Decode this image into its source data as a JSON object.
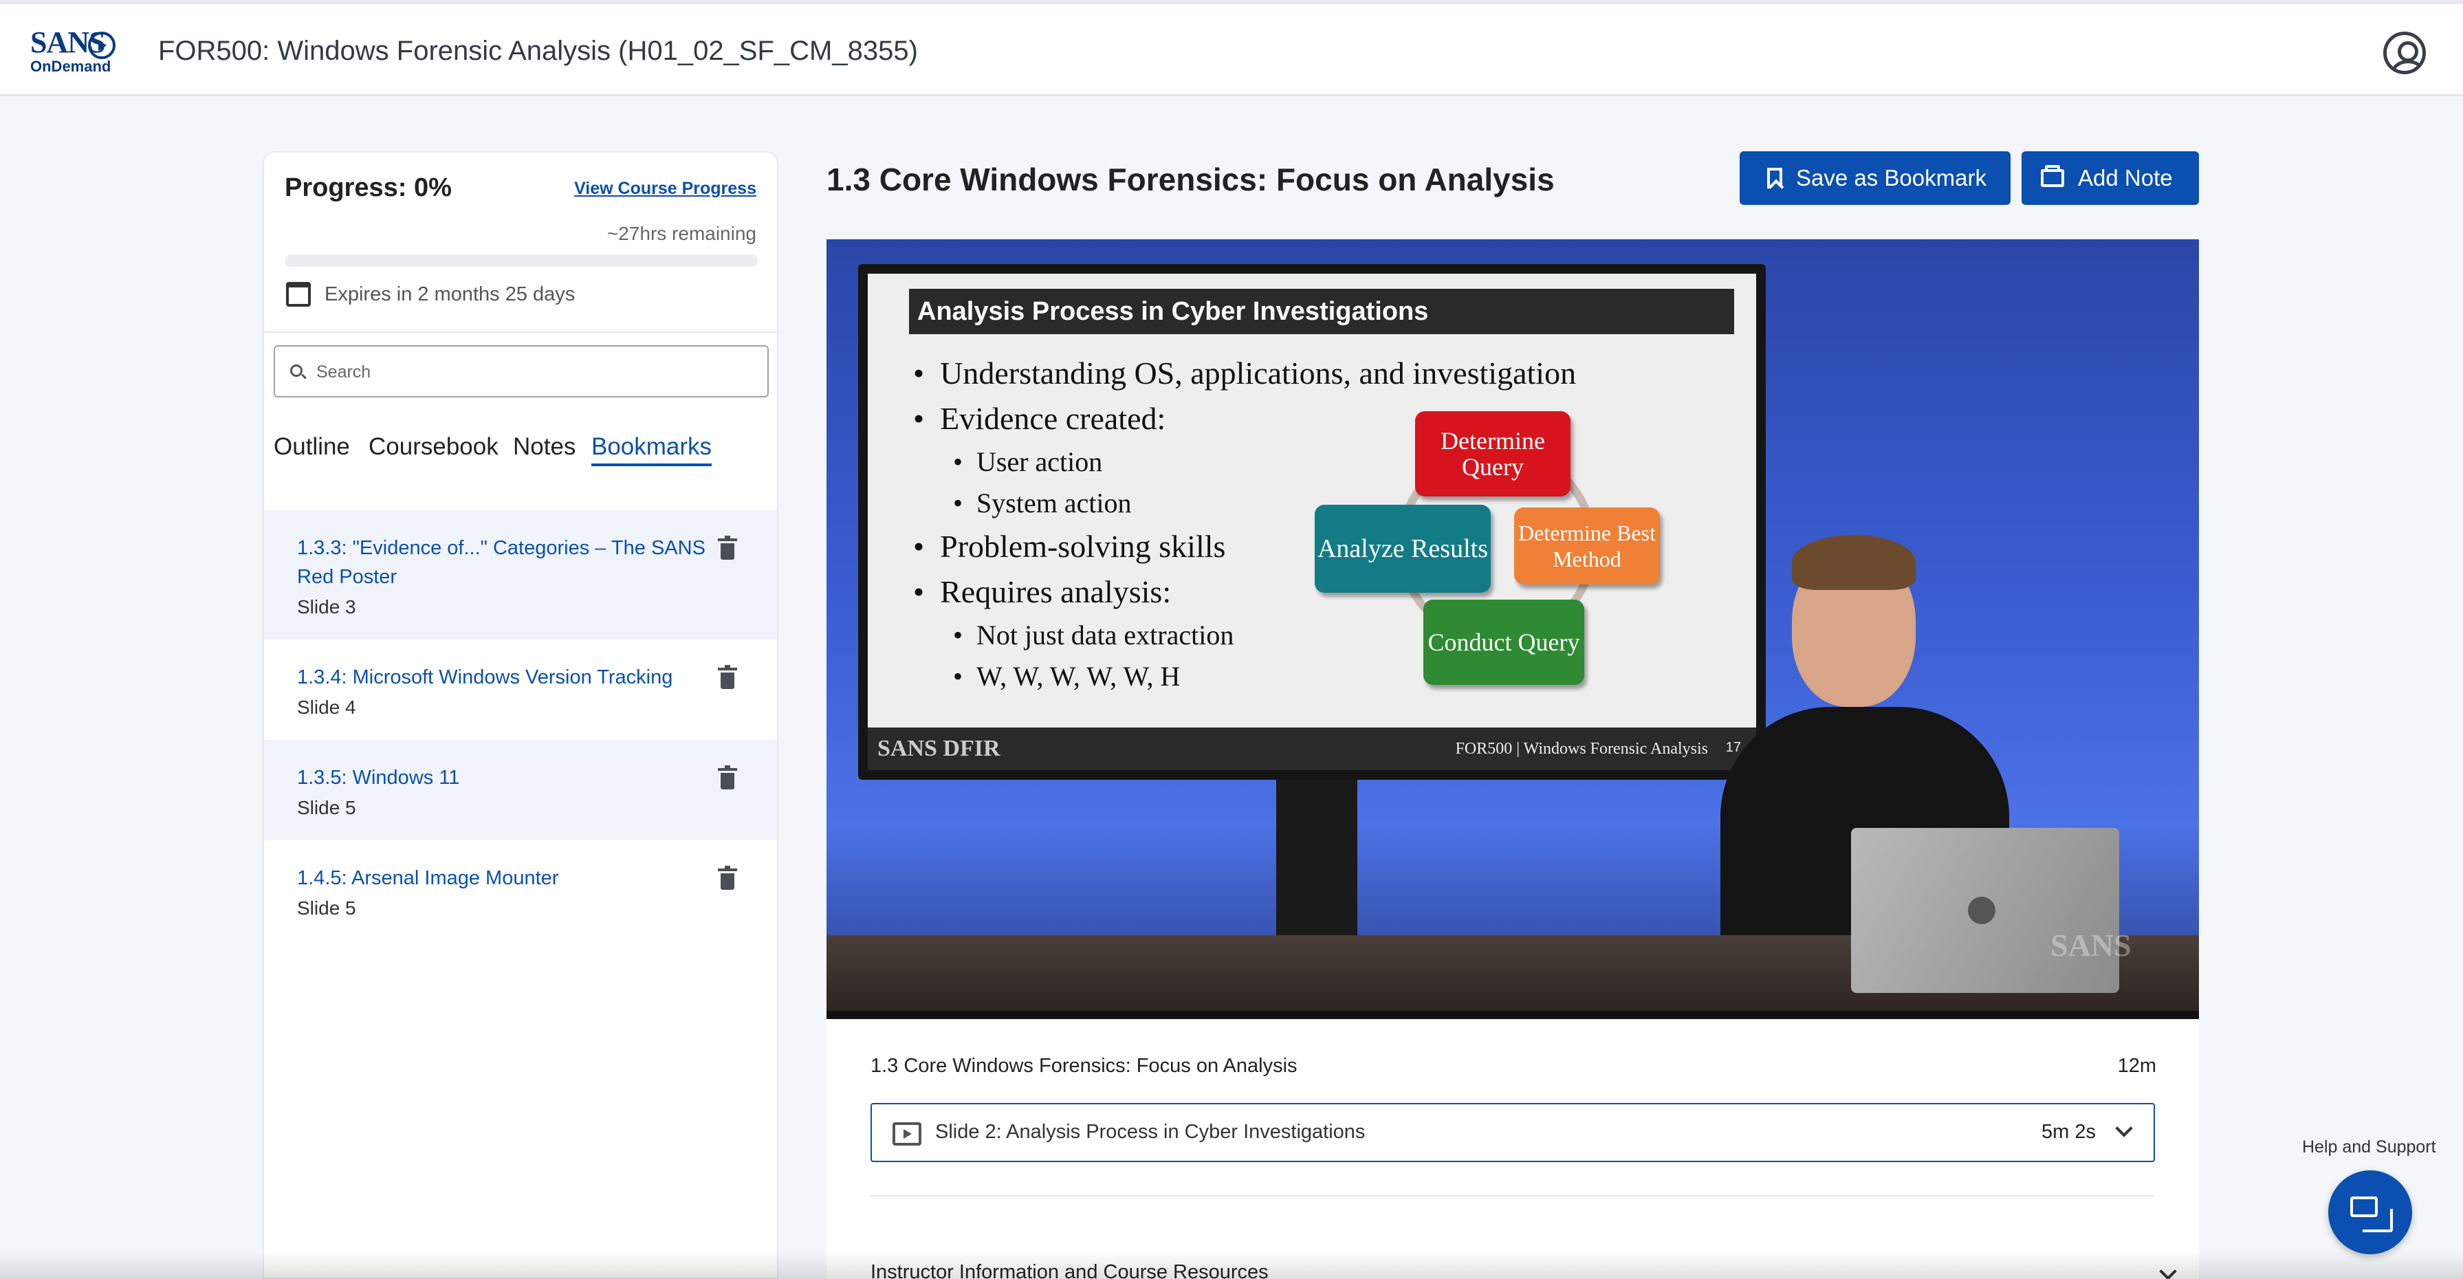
{
  "header": {
    "logo_top": "SANS",
    "logo_bottom": "OnDemand",
    "course_title": "FOR500: Windows Forensic Analysis (H01_02_SF_CM_8355)",
    "user_icon": "user-circle-icon"
  },
  "sidebar": {
    "progress_label": "Progress: 0%",
    "progress_value": 0,
    "view_progress_link": "View Course Progress",
    "remaining": "~27hrs remaining",
    "expires": "Expires in 2 months 25 days",
    "search": {
      "placeholder": "Search",
      "value": ""
    },
    "tabs": [
      {
        "label": "Outline",
        "active": false
      },
      {
        "label": "Coursebook",
        "active": false
      },
      {
        "label": "Notes",
        "active": false
      },
      {
        "label": "Bookmarks",
        "active": true
      }
    ],
    "bookmarks": [
      {
        "title": "1.3.3: \"Evidence of...\" Categories – The SANS Red Poster",
        "slide": "Slide 3"
      },
      {
        "title": "1.3.4: Microsoft Windows Version Tracking",
        "slide": "Slide 4"
      },
      {
        "title": "1.3.5: Windows 11",
        "slide": "Slide 5"
      },
      {
        "title": "1.4.5: Arsenal Image Mounter",
        "slide": "Slide 5"
      }
    ]
  },
  "main": {
    "lesson_title": "1.3 Core Windows Forensics: Focus on Analysis",
    "save_bookmark_label": "Save as Bookmark",
    "add_note_label": "Add Note",
    "video": {
      "slide_title": "Analysis Process in Cyber Investigations",
      "bullets": [
        {
          "level": 1,
          "text": "Understanding OS, applications, and investigation"
        },
        {
          "level": 1,
          "text": "Evidence created:"
        },
        {
          "level": 2,
          "text": "User action"
        },
        {
          "level": 2,
          "text": "System action"
        },
        {
          "level": 1,
          "text": "Problem-solving skills"
        },
        {
          "level": 1,
          "text": "Requires analysis:"
        },
        {
          "level": 2,
          "text": "Not just data extraction"
        },
        {
          "level": 2,
          "text": "W, W, W, W, W, H"
        }
      ],
      "cycle": {
        "determine_query": "Determine Query",
        "determine_method": "Determine Best Method",
        "conduct_query": "Conduct Query",
        "analyze_results": "Analyze Results"
      },
      "footer_logo": "SANS DFIR",
      "footer_text": "FOR500 | Windows Forensic Analysis",
      "footer_page": "17",
      "watermark": "SANS"
    },
    "details": {
      "lesson_name": "1.3 Core Windows Forensics: Focus on Analysis",
      "lesson_duration": "12m",
      "current_slide": "Slide 2: Analysis Process in Cyber Investigations",
      "current_slide_duration": "5m 2s",
      "resources_header": "Instructor Information and Course Resources"
    }
  },
  "support": {
    "help_label": "Help and Support"
  },
  "colors": {
    "accent": "#0b4fb0",
    "logo": "#0b3a7e"
  }
}
